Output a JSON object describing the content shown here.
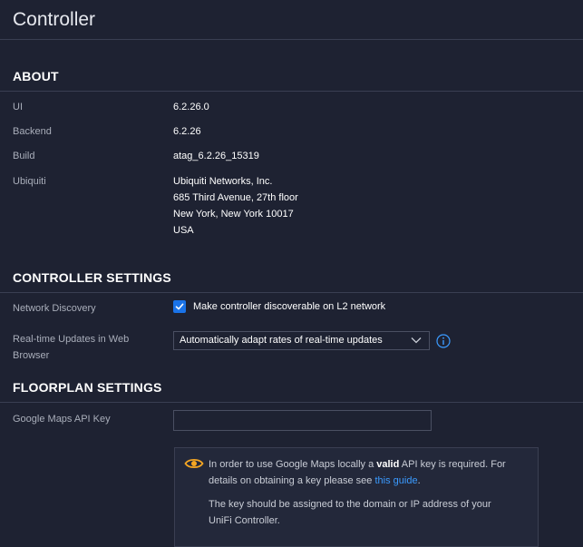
{
  "page": {
    "title": "Controller"
  },
  "about": {
    "heading": "ABOUT",
    "ui_label": "UI",
    "ui_value": "6.2.26.0",
    "backend_label": "Backend",
    "backend_value": "6.2.26",
    "build_label": "Build",
    "build_value": "atag_6.2.26_15319",
    "vendor_label": "Ubiquiti",
    "vendor_lines": [
      "Ubiquiti Networks, Inc.",
      "685 Third Avenue, 27th floor",
      "New York, New York 10017",
      "USA"
    ]
  },
  "controller_settings": {
    "heading": "CONTROLLER SETTINGS",
    "discovery_label": "Network Discovery",
    "discovery_checkbox_label": "Make controller discoverable on L2 network",
    "discovery_checked": true,
    "realtime_label_line1": "Real-time Updates in Web",
    "realtime_label_line2": "Browser",
    "realtime_selected": "Automatically adapt rates of real-time updates"
  },
  "floorplan_settings": {
    "heading": "FLOORPLAN SETTINGS",
    "maps_key_label": "Google Maps API Key",
    "maps_key_value": "",
    "notice_part1": "In order to use Google Maps locally a ",
    "notice_bold": "valid",
    "notice_part2": " API key is required. For",
    "notice_line2": "details on obtaining a key please see ",
    "notice_link": "this guide",
    "notice_period": ".",
    "notice_para2_line1": "The key should be assigned to the domain or IP address of your",
    "notice_para2_line2": "UniFi Controller."
  },
  "colors": {
    "accent": "#1a73e8",
    "link": "#3b9bff",
    "warning": "#f5a623",
    "background": "#1e2232"
  },
  "icons": {
    "checkbox": "check-icon",
    "dropdown": "chevron-down-icon",
    "info": "info-icon",
    "notice": "eye-icon"
  }
}
